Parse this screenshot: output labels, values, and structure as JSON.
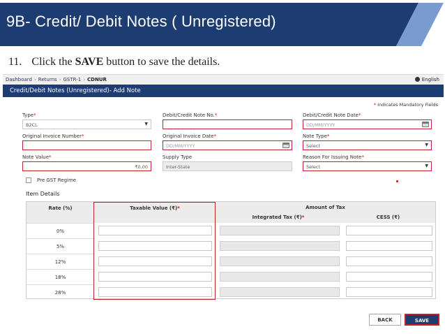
{
  "slide": {
    "title": "9B- Credit/ Debit Notes ( Unregistered)",
    "step_number": "11.",
    "step_pre": "Click the ",
    "step_bold": "SAVE",
    "step_post": " button to save the details.",
    "accent_color": "#1d3d72"
  },
  "breadcrumb": {
    "items": [
      "Dashboard",
      "Returns",
      "GSTR-1",
      "CDNUR"
    ],
    "separator": "›",
    "language_label": "English"
  },
  "header": {
    "title": "Credit/Debit Notes (Unregistered)- Add Note"
  },
  "form": {
    "mandatory_note": "Indicates Mandatory Fields",
    "type": {
      "label": "Type",
      "value": "B2CL"
    },
    "note_no": {
      "label": "Debit/Credit Note No.",
      "value": ""
    },
    "note_date": {
      "label": "Debit/Credit Note Date",
      "placeholder": "DD/MM/YYYY"
    },
    "orig_invoice_no": {
      "label": "Original Invoice Number",
      "value": ""
    },
    "orig_invoice_date": {
      "label": "Original Invoice Date",
      "placeholder": "DD/MM/YYYY"
    },
    "note_type": {
      "label": "Note Type",
      "value": "Select"
    },
    "note_value": {
      "label": "Note Value",
      "value": "₹0.00"
    },
    "supply_type": {
      "label": "Supply Type",
      "value": "Inter-State"
    },
    "reason": {
      "label": "Reason For Issuing Note",
      "value": "Select"
    },
    "pre_gst_label": "Pre GST Regime"
  },
  "items": {
    "title": "Item Details",
    "col_rate": "Rate (%)",
    "col_taxable": "Taxable Value (₹)",
    "col_amount": "Amount of Tax",
    "col_igst": "Integrated Tax (₹)",
    "col_cess": "CESS (₹)",
    "rows": [
      {
        "rate": "0%"
      },
      {
        "rate": "5%"
      },
      {
        "rate": "12%"
      },
      {
        "rate": "18%"
      },
      {
        "rate": "28%"
      }
    ]
  },
  "buttons": {
    "back": "BACK",
    "save": "SAVE"
  }
}
